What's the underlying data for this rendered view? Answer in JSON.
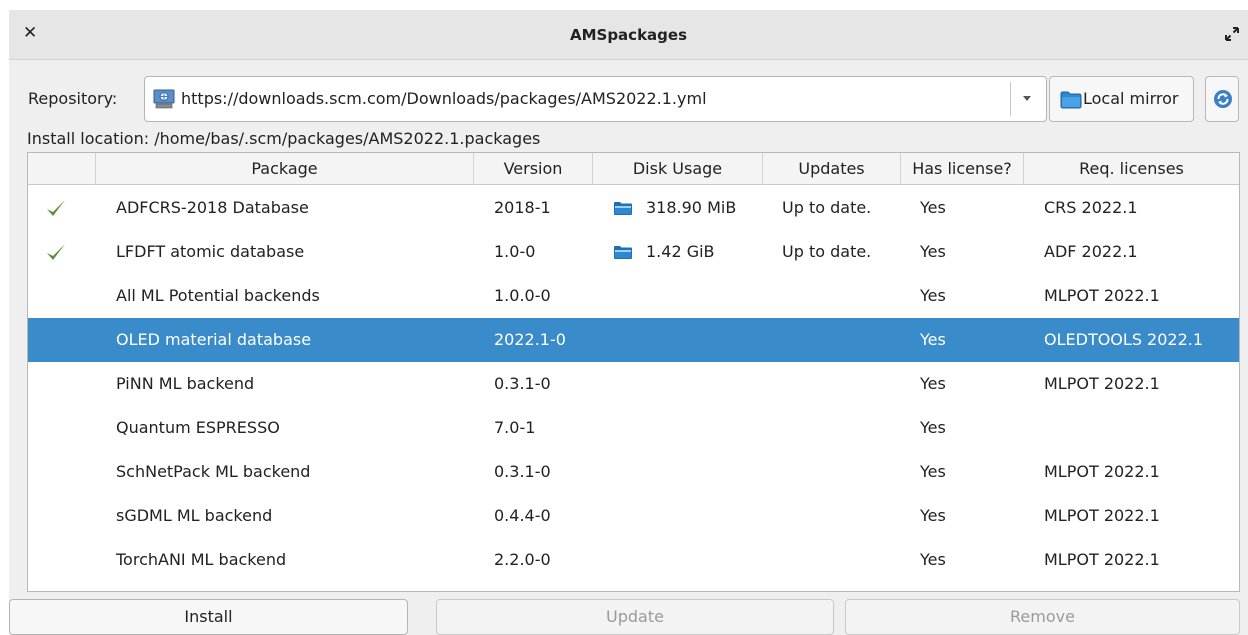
{
  "window": {
    "title": "AMSpackages",
    "close_glyph": "✕",
    "maximize_icon": "maximize-icon"
  },
  "repository": {
    "label": "Repository:",
    "url": "https://downloads.scm.com/Downloads/packages/AMS2022.1.yml",
    "icon": "web-repository-icon",
    "local_mirror_label": "Local mirror",
    "refresh_icon": "refresh-icon"
  },
  "install_location": "Install location: /home/bas/.scm/packages/AMS2022.1.packages",
  "table": {
    "columns": [
      "",
      "Package",
      "Version",
      "Disk Usage",
      "Updates",
      "Has license?",
      "Req. licenses"
    ],
    "rows": [
      {
        "installed": true,
        "package": "ADFCRS-2018 Database",
        "version": "2018-1",
        "disk_usage": "318.90 MiB",
        "updates": "Up to date.",
        "has_license": "Yes",
        "req_licenses": "CRS 2022.1",
        "selected": false
      },
      {
        "installed": true,
        "package": "LFDFT atomic database",
        "version": "1.0-0",
        "disk_usage": "1.42 GiB",
        "updates": "Up to date.",
        "has_license": "Yes",
        "req_licenses": "ADF 2022.1",
        "selected": false
      },
      {
        "installed": false,
        "package": "All ML Potential backends",
        "version": "1.0.0-0",
        "disk_usage": "",
        "updates": "",
        "has_license": "Yes",
        "req_licenses": "MLPOT 2022.1",
        "selected": false
      },
      {
        "installed": false,
        "package": "OLED material database",
        "version": "2022.1-0",
        "disk_usage": "",
        "updates": "",
        "has_license": "Yes",
        "req_licenses": "OLEDTOOLS 2022.1",
        "selected": true
      },
      {
        "installed": false,
        "package": "PiNN ML backend",
        "version": "0.3.1-0",
        "disk_usage": "",
        "updates": "",
        "has_license": "Yes",
        "req_licenses": "MLPOT 2022.1",
        "selected": false
      },
      {
        "installed": false,
        "package": "Quantum ESPRESSO",
        "version": "7.0-1",
        "disk_usage": "",
        "updates": "",
        "has_license": "Yes",
        "req_licenses": "",
        "selected": false
      },
      {
        "installed": false,
        "package": "SchNetPack ML backend",
        "version": "0.3.1-0",
        "disk_usage": "",
        "updates": "",
        "has_license": "Yes",
        "req_licenses": "MLPOT 2022.1",
        "selected": false
      },
      {
        "installed": false,
        "package": "sGDML ML backend",
        "version": "0.4.4-0",
        "disk_usage": "",
        "updates": "",
        "has_license": "Yes",
        "req_licenses": "MLPOT 2022.1",
        "selected": false
      },
      {
        "installed": false,
        "package": "TorchANI ML backend",
        "version": "2.2.0-0",
        "disk_usage": "",
        "updates": "",
        "has_license": "Yes",
        "req_licenses": "MLPOT 2022.1",
        "selected": false
      }
    ]
  },
  "buttons": {
    "install": "Install",
    "update": "Update",
    "remove": "Remove"
  },
  "colors": {
    "selection": "#3a8bc9",
    "check": "#5a8f3a",
    "folder": "#2f86d1"
  }
}
